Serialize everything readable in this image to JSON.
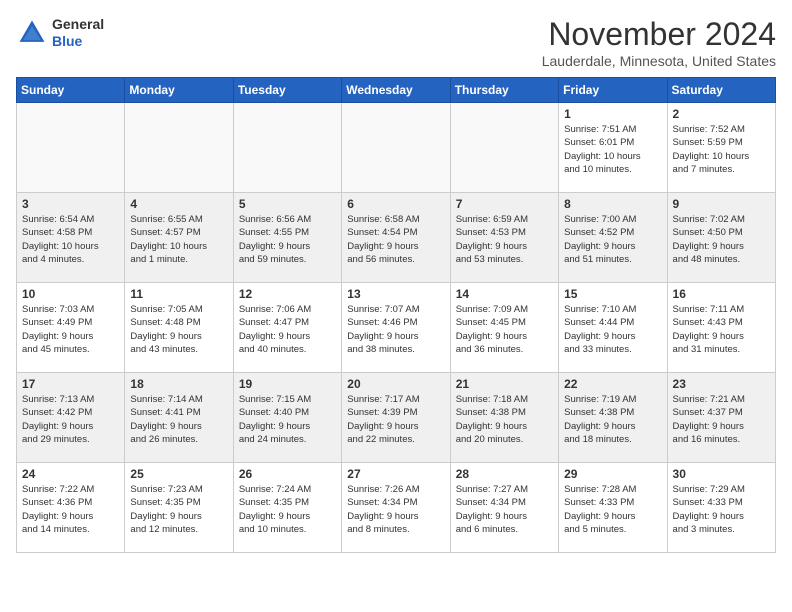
{
  "logo": {
    "line1": "General",
    "line2": "Blue"
  },
  "header": {
    "month": "November 2024",
    "location": "Lauderdale, Minnesota, United States"
  },
  "weekdays": [
    "Sunday",
    "Monday",
    "Tuesday",
    "Wednesday",
    "Thursday",
    "Friday",
    "Saturday"
  ],
  "weeks": [
    [
      {
        "day": "",
        "info": ""
      },
      {
        "day": "",
        "info": ""
      },
      {
        "day": "",
        "info": ""
      },
      {
        "day": "",
        "info": ""
      },
      {
        "day": "",
        "info": ""
      },
      {
        "day": "1",
        "info": "Sunrise: 7:51 AM\nSunset: 6:01 PM\nDaylight: 10 hours\nand 10 minutes."
      },
      {
        "day": "2",
        "info": "Sunrise: 7:52 AM\nSunset: 5:59 PM\nDaylight: 10 hours\nand 7 minutes."
      }
    ],
    [
      {
        "day": "3",
        "info": "Sunrise: 6:54 AM\nSunset: 4:58 PM\nDaylight: 10 hours\nand 4 minutes."
      },
      {
        "day": "4",
        "info": "Sunrise: 6:55 AM\nSunset: 4:57 PM\nDaylight: 10 hours\nand 1 minute."
      },
      {
        "day": "5",
        "info": "Sunrise: 6:56 AM\nSunset: 4:55 PM\nDaylight: 9 hours\nand 59 minutes."
      },
      {
        "day": "6",
        "info": "Sunrise: 6:58 AM\nSunset: 4:54 PM\nDaylight: 9 hours\nand 56 minutes."
      },
      {
        "day": "7",
        "info": "Sunrise: 6:59 AM\nSunset: 4:53 PM\nDaylight: 9 hours\nand 53 minutes."
      },
      {
        "day": "8",
        "info": "Sunrise: 7:00 AM\nSunset: 4:52 PM\nDaylight: 9 hours\nand 51 minutes."
      },
      {
        "day": "9",
        "info": "Sunrise: 7:02 AM\nSunset: 4:50 PM\nDaylight: 9 hours\nand 48 minutes."
      }
    ],
    [
      {
        "day": "10",
        "info": "Sunrise: 7:03 AM\nSunset: 4:49 PM\nDaylight: 9 hours\nand 45 minutes."
      },
      {
        "day": "11",
        "info": "Sunrise: 7:05 AM\nSunset: 4:48 PM\nDaylight: 9 hours\nand 43 minutes."
      },
      {
        "day": "12",
        "info": "Sunrise: 7:06 AM\nSunset: 4:47 PM\nDaylight: 9 hours\nand 40 minutes."
      },
      {
        "day": "13",
        "info": "Sunrise: 7:07 AM\nSunset: 4:46 PM\nDaylight: 9 hours\nand 38 minutes."
      },
      {
        "day": "14",
        "info": "Sunrise: 7:09 AM\nSunset: 4:45 PM\nDaylight: 9 hours\nand 36 minutes."
      },
      {
        "day": "15",
        "info": "Sunrise: 7:10 AM\nSunset: 4:44 PM\nDaylight: 9 hours\nand 33 minutes."
      },
      {
        "day": "16",
        "info": "Sunrise: 7:11 AM\nSunset: 4:43 PM\nDaylight: 9 hours\nand 31 minutes."
      }
    ],
    [
      {
        "day": "17",
        "info": "Sunrise: 7:13 AM\nSunset: 4:42 PM\nDaylight: 9 hours\nand 29 minutes."
      },
      {
        "day": "18",
        "info": "Sunrise: 7:14 AM\nSunset: 4:41 PM\nDaylight: 9 hours\nand 26 minutes."
      },
      {
        "day": "19",
        "info": "Sunrise: 7:15 AM\nSunset: 4:40 PM\nDaylight: 9 hours\nand 24 minutes."
      },
      {
        "day": "20",
        "info": "Sunrise: 7:17 AM\nSunset: 4:39 PM\nDaylight: 9 hours\nand 22 minutes."
      },
      {
        "day": "21",
        "info": "Sunrise: 7:18 AM\nSunset: 4:38 PM\nDaylight: 9 hours\nand 20 minutes."
      },
      {
        "day": "22",
        "info": "Sunrise: 7:19 AM\nSunset: 4:38 PM\nDaylight: 9 hours\nand 18 minutes."
      },
      {
        "day": "23",
        "info": "Sunrise: 7:21 AM\nSunset: 4:37 PM\nDaylight: 9 hours\nand 16 minutes."
      }
    ],
    [
      {
        "day": "24",
        "info": "Sunrise: 7:22 AM\nSunset: 4:36 PM\nDaylight: 9 hours\nand 14 minutes."
      },
      {
        "day": "25",
        "info": "Sunrise: 7:23 AM\nSunset: 4:35 PM\nDaylight: 9 hours\nand 12 minutes."
      },
      {
        "day": "26",
        "info": "Sunrise: 7:24 AM\nSunset: 4:35 PM\nDaylight: 9 hours\nand 10 minutes."
      },
      {
        "day": "27",
        "info": "Sunrise: 7:26 AM\nSunset: 4:34 PM\nDaylight: 9 hours\nand 8 minutes."
      },
      {
        "day": "28",
        "info": "Sunrise: 7:27 AM\nSunset: 4:34 PM\nDaylight: 9 hours\nand 6 minutes."
      },
      {
        "day": "29",
        "info": "Sunrise: 7:28 AM\nSunset: 4:33 PM\nDaylight: 9 hours\nand 5 minutes."
      },
      {
        "day": "30",
        "info": "Sunrise: 7:29 AM\nSunset: 4:33 PM\nDaylight: 9 hours\nand 3 minutes."
      }
    ]
  ]
}
